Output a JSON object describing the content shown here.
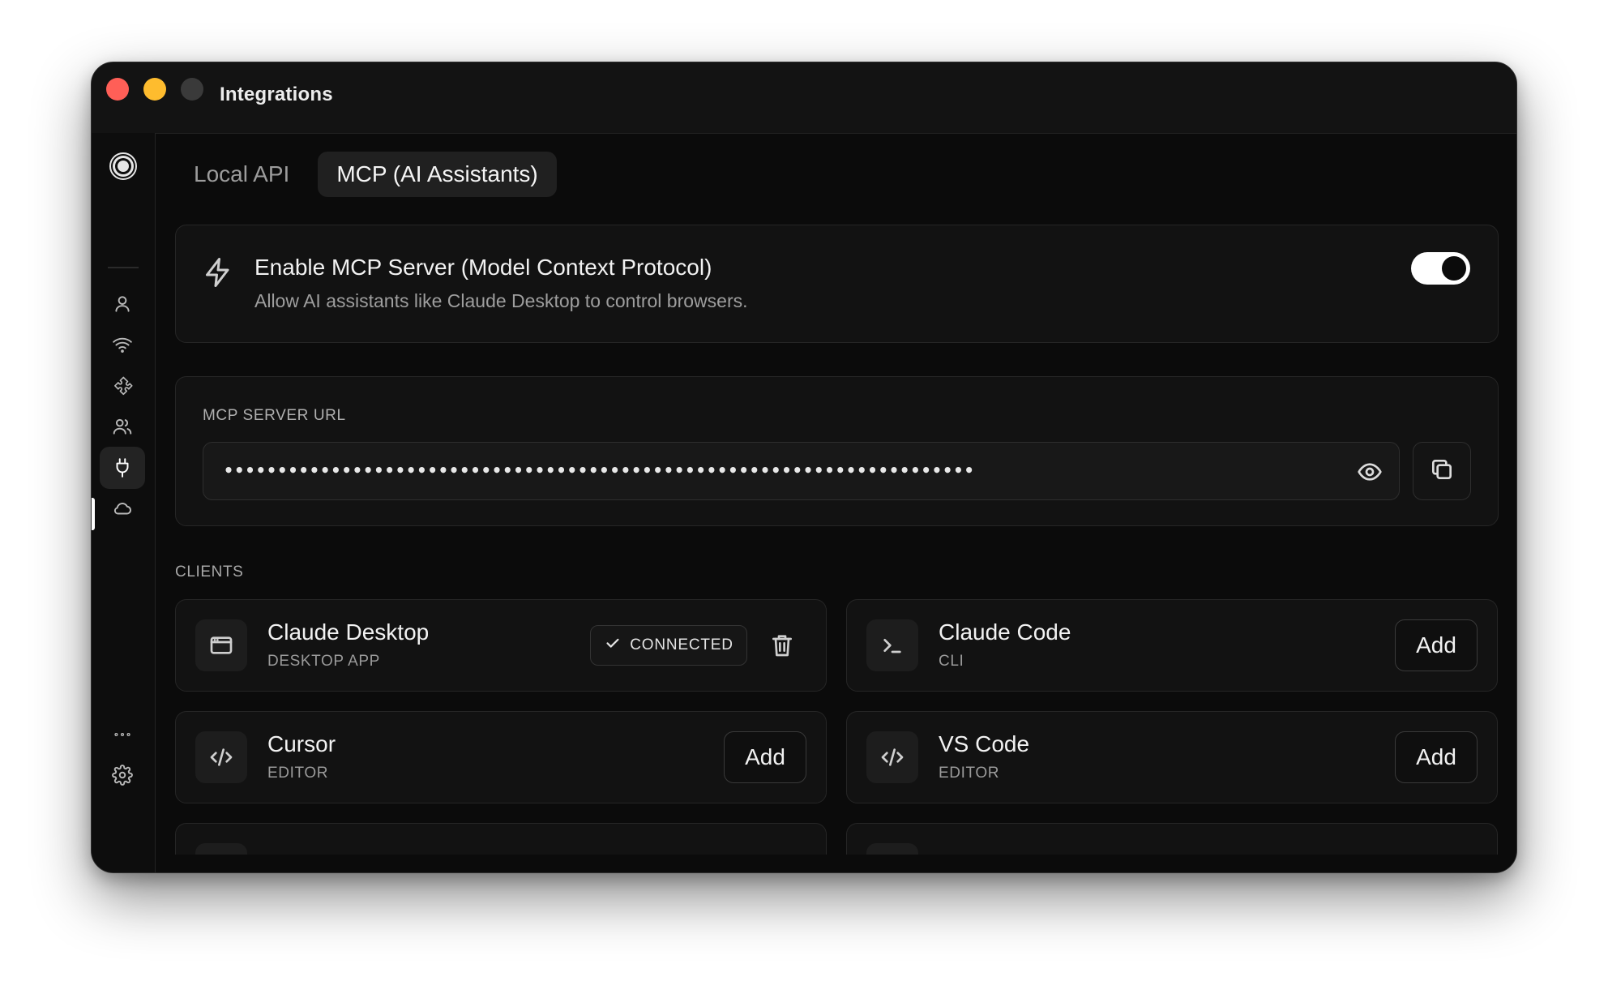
{
  "window": {
    "title": "Integrations"
  },
  "sidebar": {
    "items": [
      {
        "icon": "user-icon"
      },
      {
        "icon": "wifi-icon"
      },
      {
        "icon": "puzzle-icon"
      },
      {
        "icon": "users-icon"
      },
      {
        "icon": "plug-icon",
        "active": true
      },
      {
        "icon": "cloud-icon"
      },
      {
        "icon": "more-icon"
      },
      {
        "icon": "gear-icon"
      }
    ]
  },
  "tabs": [
    {
      "label": "Local API",
      "active": false
    },
    {
      "label": "MCP (AI Assistants)",
      "active": true
    }
  ],
  "mcp": {
    "title": "Enable MCP Server (Model Context Protocol)",
    "description": "Allow AI assistants like Claude Desktop to control browsers.",
    "enabled": true
  },
  "server_url": {
    "label": "MCP SERVER URL",
    "masked_value": "••••••••••••••••••••••••••••••••••••••••••••••••••••••••••••••••••••••"
  },
  "clients": {
    "label": "CLIENTS",
    "items": [
      {
        "name": "Claude Desktop",
        "type": "DESKTOP APP",
        "icon": "window-icon",
        "status": "CONNECTED"
      },
      {
        "name": "Claude Code",
        "type": "CLI",
        "icon": "terminal-icon",
        "action": "Add"
      },
      {
        "name": "Cursor",
        "type": "EDITOR",
        "icon": "code-icon",
        "action": "Add"
      },
      {
        "name": "VS Code",
        "type": "EDITOR",
        "icon": "code-icon",
        "action": "Add"
      }
    ]
  },
  "colors": {
    "background": "#0b0b0b",
    "card": "#121212",
    "accent": "#ffffff",
    "traffic_red": "#ff5f57",
    "traffic_yellow": "#febc2e"
  }
}
